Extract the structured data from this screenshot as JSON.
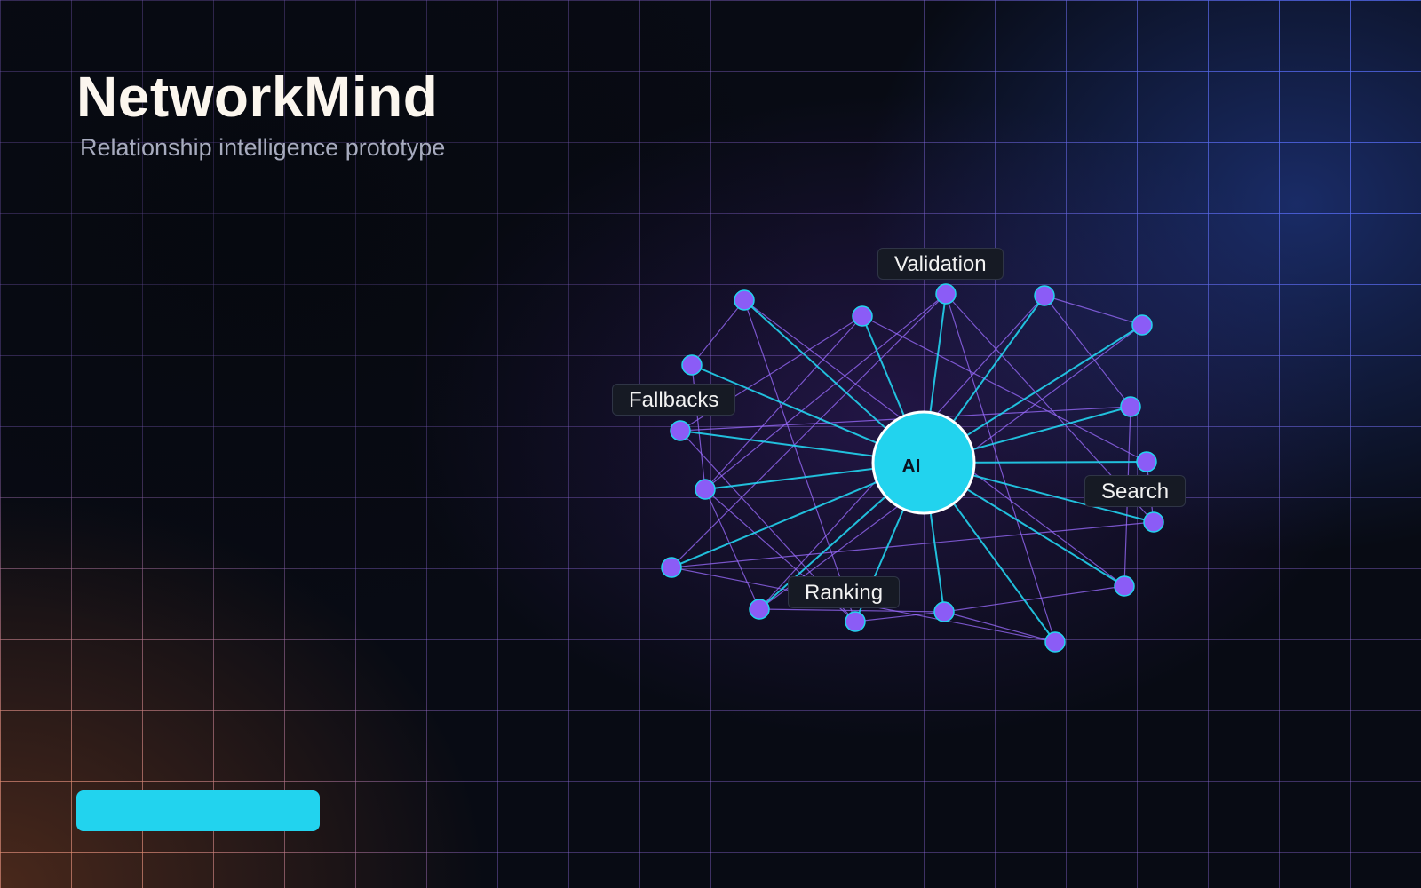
{
  "app": {
    "title": "NetworkMind",
    "subtitle": "Relationship intelligence prototype"
  },
  "graph": {
    "hub_label": "AI",
    "tags": [
      {
        "id": "validation",
        "label": "Validation"
      },
      {
        "id": "fallbacks",
        "label": "Fallbacks"
      },
      {
        "id": "search",
        "label": "Search"
      },
      {
        "id": "ranking",
        "label": "Ranking"
      }
    ]
  },
  "colors": {
    "accent": "#22d3ee",
    "node": "#8b5cf6",
    "title": "#fbf6ee",
    "subtitle": "#a7abbe"
  }
}
